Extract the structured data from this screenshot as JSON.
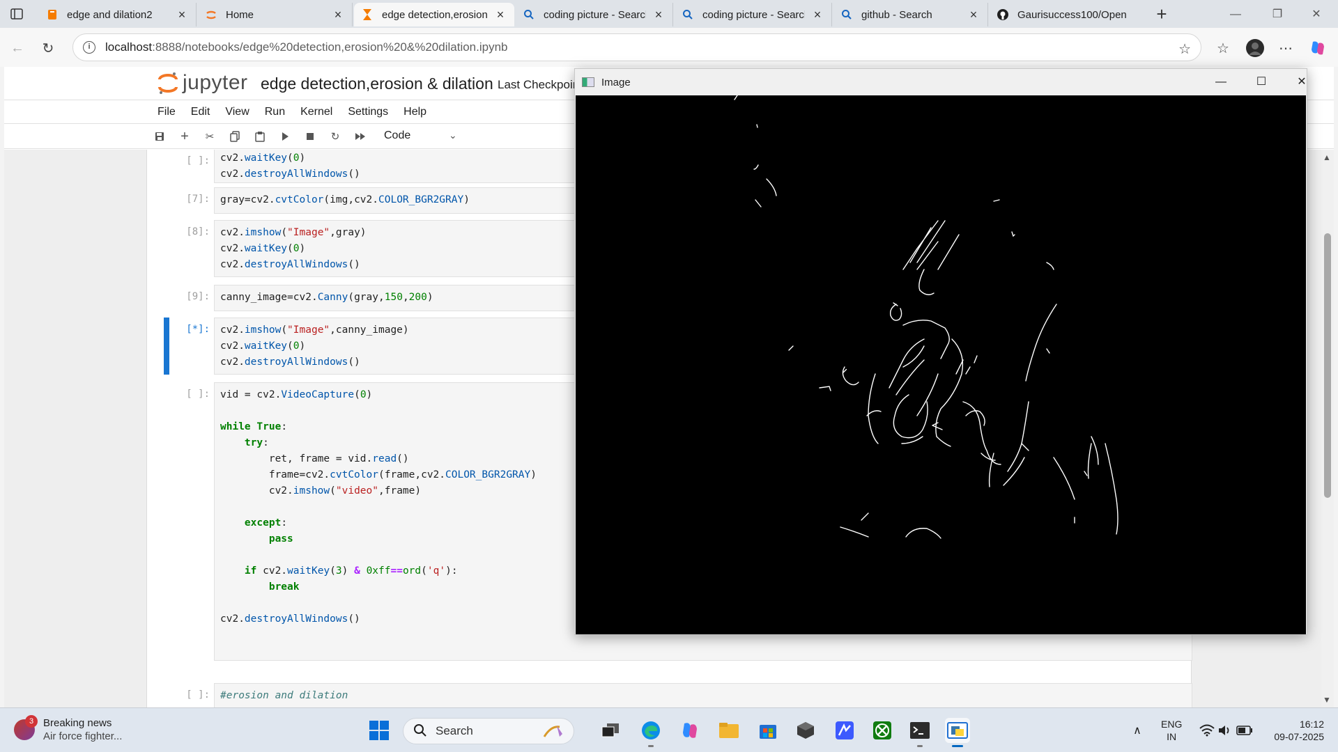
{
  "browser": {
    "tabs": [
      {
        "title": "edge and dilation2",
        "icon": "book-icon",
        "active": false
      },
      {
        "title": "Home",
        "icon": "jupyter-icon",
        "active": false
      },
      {
        "title": "edge detection,erosion",
        "icon": "hourglass-icon",
        "active": true
      },
      {
        "title": "coding picture - Search",
        "icon": "search-icon",
        "active": false
      },
      {
        "title": "coding picture - Search",
        "icon": "search-icon",
        "active": false
      },
      {
        "title": "github - Search",
        "icon": "search-icon",
        "active": false
      },
      {
        "title": "Gaurisuccess100/Open",
        "icon": "github-icon",
        "active": false
      }
    ],
    "url_host": "localhost",
    "url_path": ":8888/notebooks/edge%20detection,erosion%20&%20dilation.ipynb"
  },
  "jupyter": {
    "logo_text": "jupyter",
    "notebook_title": "edge detection,erosion & dilation",
    "checkpoint": "Last Checkpoint",
    "menu": [
      "File",
      "Edit",
      "View",
      "Run",
      "Kernel",
      "Settings",
      "Help"
    ],
    "cell_type": "Code"
  },
  "cells": [
    {
      "prompt": "[ ]:",
      "code": "cv2.waitKey(0)\ncv2.destroyAllWindows()"
    },
    {
      "prompt": "[7]:",
      "code": "gray=cv2.cvtColor(img,cv2.COLOR_BGR2GRAY)"
    },
    {
      "prompt": "[8]:",
      "code": "cv2.imshow(\"Image\",gray)\ncv2.waitKey(0)\ncv2.destroyAllWindows()"
    },
    {
      "prompt": "[9]:",
      "code": "canny_image=cv2.Canny(gray,150,200)"
    },
    {
      "prompt": "[*]:",
      "code": "cv2.imshow(\"Image\",canny_image)\ncv2.waitKey(0)\ncv2.destroyAllWindows()",
      "active": true
    },
    {
      "prompt": "[ ]:",
      "code": "vid = cv2.VideoCapture(0)\n\nwhile True:\n    try:\n        ret, frame = vid.read()\n        frame=cv2.cvtColor(frame,cv2.COLOR_BGR2GRAY)\n        cv2.imshow(\"video\",frame)\n\n    except:\n        pass\n\n    if cv2.waitKey(3) & 0xff==ord('q'):\n        break\n\ncv2.destroyAllWindows()"
    },
    {
      "prompt": "[ ]:",
      "code": "#erosion and dilation"
    }
  ],
  "image_window": {
    "title": "Image"
  },
  "taskbar": {
    "news_badge": "3",
    "news_title": "Breaking news",
    "news_subtitle": "Air force fighter...",
    "search_placeholder": "Search",
    "lang_top": "ENG",
    "lang_bottom": "IN",
    "time": "16:12",
    "date": "09-07-2025"
  }
}
